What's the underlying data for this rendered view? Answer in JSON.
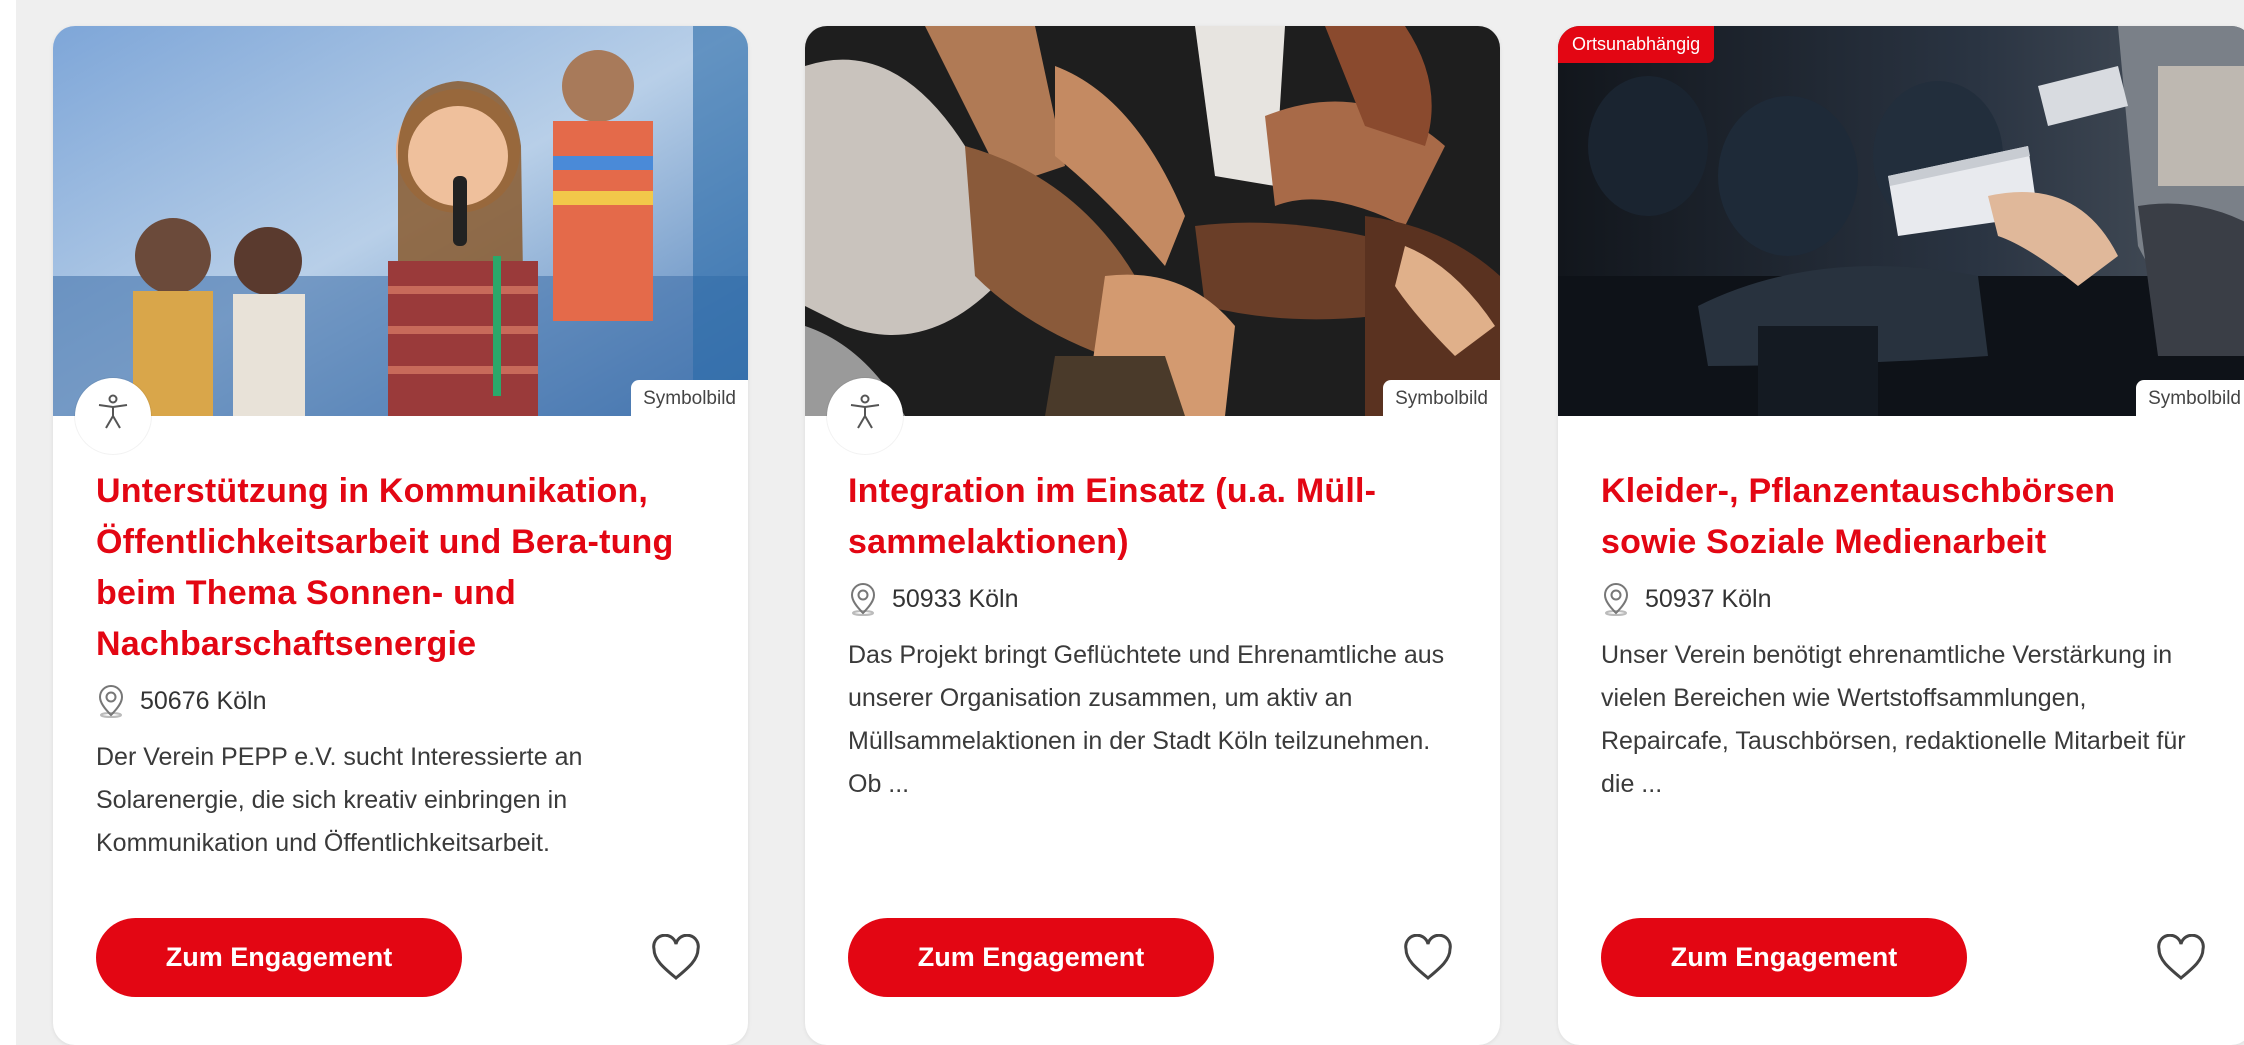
{
  "cards": [
    {
      "title": "Unterstützung in Kommunikation, Öffentlichkeitsarbeit und Bera-tung beim Thema Sonnen- und Nachbarschaftsenergie",
      "location": "50676 Köln",
      "description": "Der Verein PEPP e.V. sucht Interessierte an Solarenergie, die sich kreativ einbringen in Kommunikation und Öffentlichkeitsarbeit.",
      "image_label": "Symbolbild",
      "badge": "",
      "button_label": "Zum Engagement",
      "accessibility_icon": "accessibility-icon",
      "favorite_icon": "heart-outline-icon"
    },
    {
      "title": "Integration im Einsatz (u.a. Müll-sammelaktionen)",
      "location": "50933 Köln",
      "description": "Das Projekt bringt Geflüchtete und Ehrenamtliche aus unserer Organisation zusammen, um aktiv an Müllsammelaktionen in der Stadt Köln teilzunehmen. Ob ...",
      "image_label": "Symbolbild",
      "badge": "",
      "button_label": "Zum Engagement",
      "accessibility_icon": "accessibility-icon",
      "favorite_icon": "heart-outline-icon"
    },
    {
      "title": "Kleider-, Pflanzentauschbörsen sowie Soziale Medienarbeit",
      "location": "50937 Köln",
      "description": "Unser Verein benötigt ehrenamtliche Verstärkung in vielen Bereichen wie Wertstoffsammlungen, Repaircafe, Tauschbörsen, redaktionelle Mitarbeit für die ...",
      "image_label": "Symbolbild",
      "badge": "Ortsunabhängig",
      "button_label": "Zum Engagement",
      "accessibility_icon": "",
      "favorite_icon": "heart-outline-icon"
    }
  ],
  "colors": {
    "brand_red": "#e30613",
    "text": "#3a3a3a",
    "page_background": "#efefef"
  }
}
